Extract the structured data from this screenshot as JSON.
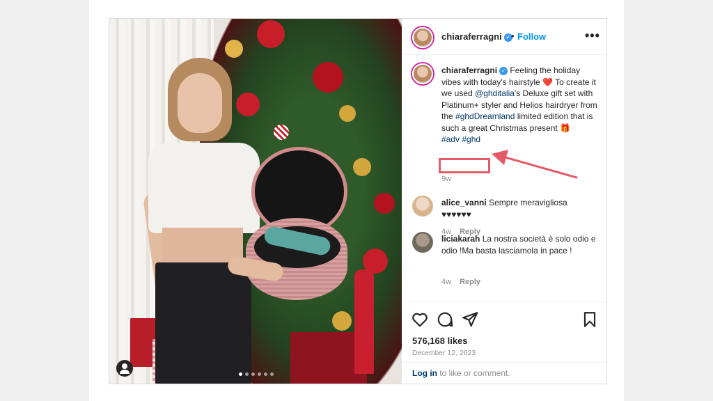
{
  "post": {
    "username": "chiaraferragni",
    "header_separator": "•",
    "follow_label": "Follow",
    "more_label": "•••",
    "caption": {
      "username": "chiaraferragni",
      "text_1": " Feeling the holiday vibes with today's hairstyle ",
      "emoji_heart": "❤️",
      "text_2": " To create it we used ",
      "mention": "@ghditalia",
      "text_3": "'s Deluxe gift set with Platinum+ styler and Helios hairdryer from the ",
      "tag_dreamland": "#ghdDreamland",
      "text_4": " limited edition that is such a great Christmas present ",
      "emoji_gift": "🎁",
      "tag_adv": "#adv",
      "tag_ghd": "#ghd",
      "time": "9w"
    },
    "comments": [
      {
        "username": "alice_vanni",
        "text": "Sempre meravigliosa",
        "hearts": "♥♥♥♥♥♥",
        "time": "4w",
        "reply_label": "Reply"
      },
      {
        "username": "liciakarah",
        "text": "La nostra società è solo odio e odio !Ma basta lasciamola in pace !",
        "time": "4w",
        "reply_label": "Reply"
      }
    ],
    "likes": "576,168 likes",
    "date": "December 12, 2023",
    "login_link": "Log in",
    "login_suffix": " to like or comment."
  },
  "colors": {
    "link": "#0095f6",
    "hashtag": "#00376b",
    "highlight": "#e35b66",
    "verified": "#3897f0"
  },
  "icons": [
    "user-icon",
    "verified-icon",
    "more-icon",
    "heart-icon",
    "comment-icon",
    "share-icon",
    "bookmark-icon",
    "arrow-icon"
  ],
  "carousel": {
    "count": 6,
    "active": 1
  }
}
